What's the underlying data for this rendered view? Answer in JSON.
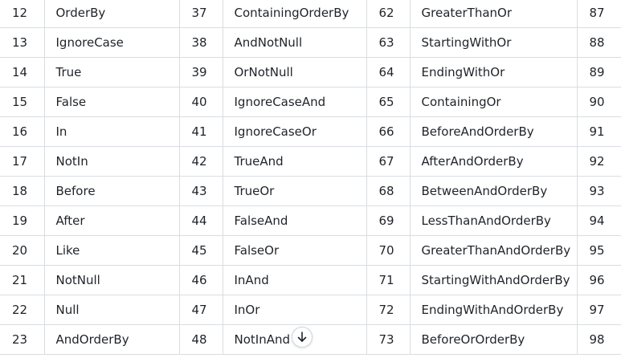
{
  "table": {
    "rows": [
      [
        "12",
        "OrderBy",
        "37",
        "ContainingOrderBy",
        "62",
        "GreaterThanOr",
        "87"
      ],
      [
        "13",
        "IgnoreCase",
        "38",
        "AndNotNull",
        "63",
        "StartingWithOr",
        "88"
      ],
      [
        "14",
        "True",
        "39",
        "OrNotNull",
        "64",
        "EndingWithOr",
        "89"
      ],
      [
        "15",
        "False",
        "40",
        "IgnoreCaseAnd",
        "65",
        "ContainingOr",
        "90"
      ],
      [
        "16",
        "In",
        "41",
        "IgnoreCaseOr",
        "66",
        "BeforeAndOrderBy",
        "91"
      ],
      [
        "17",
        "NotIn",
        "42",
        "TrueAnd",
        "67",
        "AfterAndOrderBy",
        "92"
      ],
      [
        "18",
        "Before",
        "43",
        "TrueOr",
        "68",
        "BetweenAndOrderBy",
        "93"
      ],
      [
        "19",
        "After",
        "44",
        "FalseAnd",
        "69",
        "LessThanAndOrderBy",
        "94"
      ],
      [
        "20",
        "Like",
        "45",
        "FalseOr",
        "70",
        "GreaterThanAndOrderBy",
        "95"
      ],
      [
        "21",
        "NotNull",
        "46",
        "InAnd",
        "71",
        "StartingWithAndOrderBy",
        "96"
      ],
      [
        "22",
        "Null",
        "47",
        "InOr",
        "72",
        "EndingWithAndOrderBy",
        "97"
      ],
      [
        "23",
        "AndOrderBy",
        "48",
        "NotInAnd",
        "73",
        "BeforeOrOrderBy",
        "98"
      ]
    ]
  },
  "scroll_button": {
    "icon": "arrow-down-icon"
  },
  "colors": {
    "border": "#d9dde1",
    "text": "#1f2328",
    "background": "#ffffff"
  }
}
